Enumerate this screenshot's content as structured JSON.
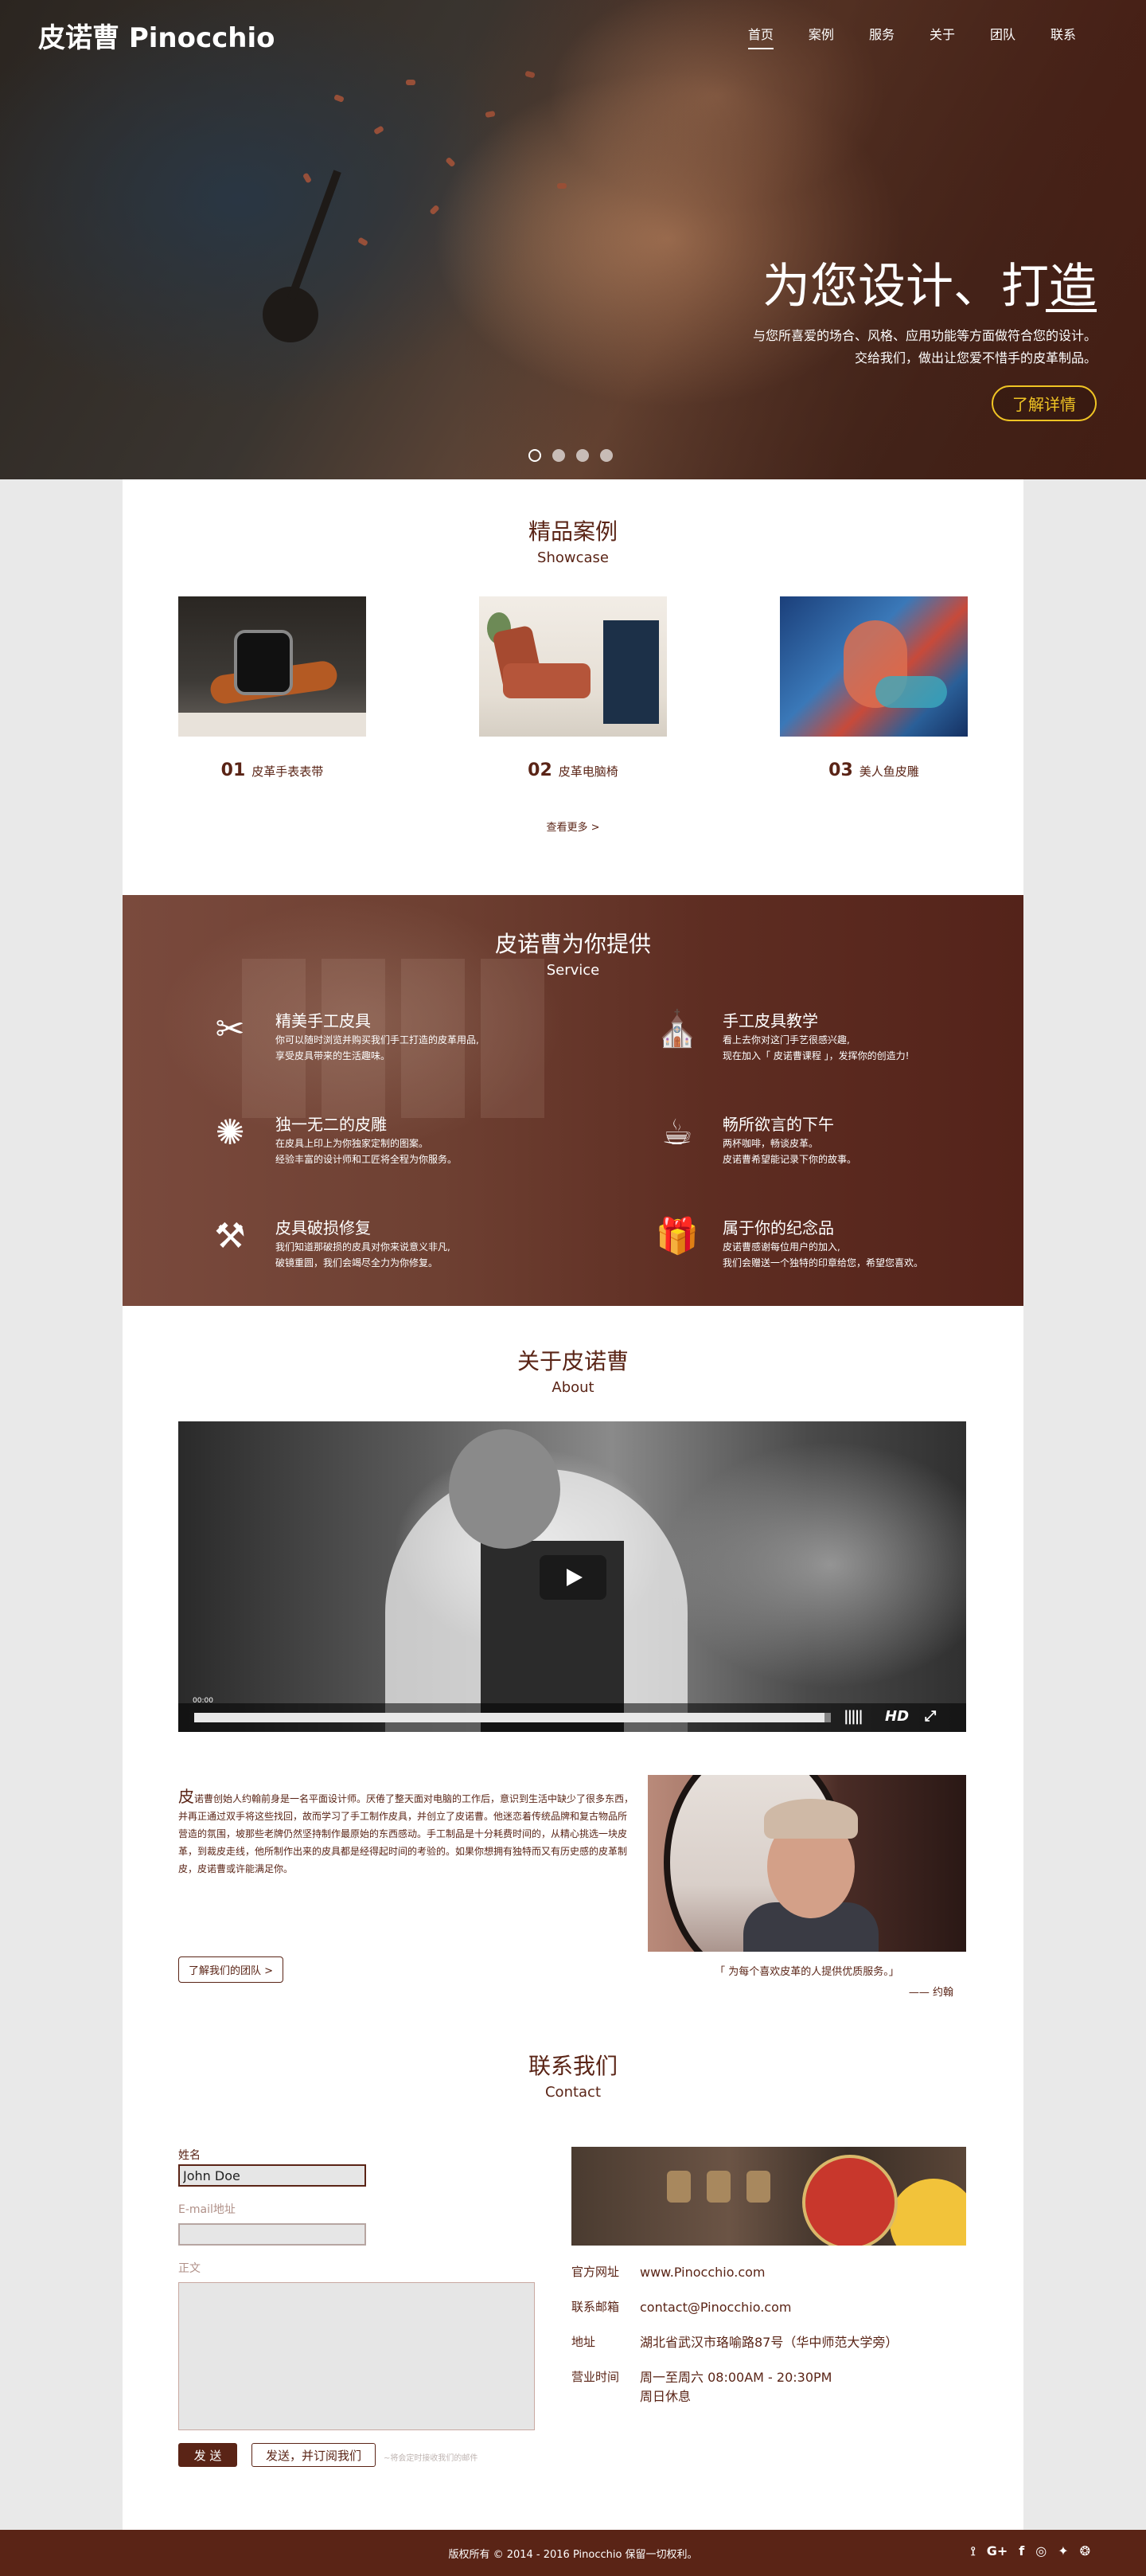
{
  "brand": {
    "logo": "皮诺曹 Pinocchio"
  },
  "nav": [
    "首页",
    "案例",
    "服务",
    "关于",
    "团队",
    "联系"
  ],
  "hero": {
    "title": "为您设计、打造",
    "subtitle_line1": "与您所喜爱的场合、风格、应用功能等方面做符合您的设计。",
    "subtitle_line2": "交给我们，做出让您爱不惜手的皮革制品。",
    "button": "了解详情"
  },
  "showcase": {
    "title": "精品案例",
    "subtitle": "Showcase",
    "items": [
      {
        "num": "01",
        "name": "皮革手表表带"
      },
      {
        "num": "02",
        "name": "皮革电脑椅"
      },
      {
        "num": "03",
        "name": "美人鱼皮雕"
      }
    ],
    "more": "查看更多 >"
  },
  "service": {
    "title": "皮诺曹为你提供",
    "subtitle": "Service",
    "items": [
      {
        "icon": "scissors-icon",
        "glyph": "✂",
        "title": "精美手工皮具",
        "desc1": "你可以随时浏览并购买我们手工打造的皮革用品,",
        "desc2": "享受皮具带来的生活趣味。"
      },
      {
        "icon": "school-icon",
        "glyph": "⛪",
        "title": "手工皮具教学",
        "desc1": "看上去你对这门手艺很感兴趣,",
        "desc2": "现在加入「 皮诺曹课程 」，发挥你的创造力!"
      },
      {
        "icon": "carving-icon",
        "glyph": "✺",
        "title": "独一无二的皮雕",
        "desc1": "在皮具上印上为你独家定制的图案。",
        "desc2": "经验丰富的设计师和工匠将全程为你服务。"
      },
      {
        "icon": "tea-cake-icon",
        "glyph": "☕",
        "title": "畅所欲言的下午",
        "desc1": "两杯咖啡，畅谈皮革。",
        "desc2": "皮诺曹希望能记录下你的故事。"
      },
      {
        "icon": "repair-kit-icon",
        "glyph": "⚒",
        "title": "皮具破损修复",
        "desc1": "我们知道那破损的皮具对你来说意义非凡,",
        "desc2": "破镜重圆，我们会竭尽全力为你修复。"
      },
      {
        "icon": "gift-icon",
        "glyph": "🎁",
        "title": "属于你的纪念品",
        "desc1": "皮诺曹感谢每位用户的加入,",
        "desc2": "我们会赠送一个独特的印章给您，希望您喜欢。"
      }
    ]
  },
  "about": {
    "title": "关于皮诺曹",
    "subtitle": "About",
    "video": {
      "time": "00:00",
      "progress": 0.99,
      "hd": "HD"
    },
    "text_cap": "皮",
    "text": "诺曹创始人约翰前身是一名平面设计师。厌倦了整天面对电脑的工作后，意识到生活中缺少了很多东西，并再正通过双手将这些找回，故而学习了手工制作皮具，并创立了皮诺曹。他迷恋着传统品牌和复古物品所营造的氛围，坡那些老牌仍然坚持制作最原始的东西感动。手工制品是十分耗费时间的，从精心挑选一块皮革，到裁皮走线，他所制作出来的皮具都是经得起时间的考验的。如果你想拥有独特而又有历史感的皮革制皮，皮诺曹或许能满足你。",
    "button": "了解我们的团队  >",
    "quote": "「 为每个喜欢皮革的人提供优质服务。」",
    "quote_by": "—— 约翰"
  },
  "contact": {
    "title": "联系我们",
    "subtitle": "Contact",
    "name_label": "姓名",
    "name_value": "John Doe",
    "email_label": "E-mail地址",
    "body_label": "正文",
    "send": "发 送",
    "send_subscribe": "发送，并订阅我们",
    "note": "~将会定时接收我们的邮件",
    "info": [
      {
        "k": "官方网址",
        "v": "www.Pinocchio.com"
      },
      {
        "k": "联系邮箱",
        "v": "contact@Pinocchio.com"
      },
      {
        "k": "地址",
        "v": "湖北省武汉市珞喻路87号（华中师范大学旁）"
      },
      {
        "k": "营业时间",
        "v": "周一至周六 08:00AM - 20:30PM",
        "v2": "周日休息"
      }
    ]
  },
  "footer": {
    "copyright": "版权所有 © 2014 - 2016 Pinocchio 保留一切权利。",
    "social": [
      {
        "name": "rss-icon",
        "glyph": "⟟"
      },
      {
        "name": "google-plus-icon",
        "glyph": "G+"
      },
      {
        "name": "facebook-icon",
        "glyph": "f"
      },
      {
        "name": "instagram-icon",
        "glyph": "◎"
      },
      {
        "name": "weibo-icon",
        "glyph": "✦"
      },
      {
        "name": "wechat-icon",
        "glyph": "❂"
      }
    ]
  }
}
